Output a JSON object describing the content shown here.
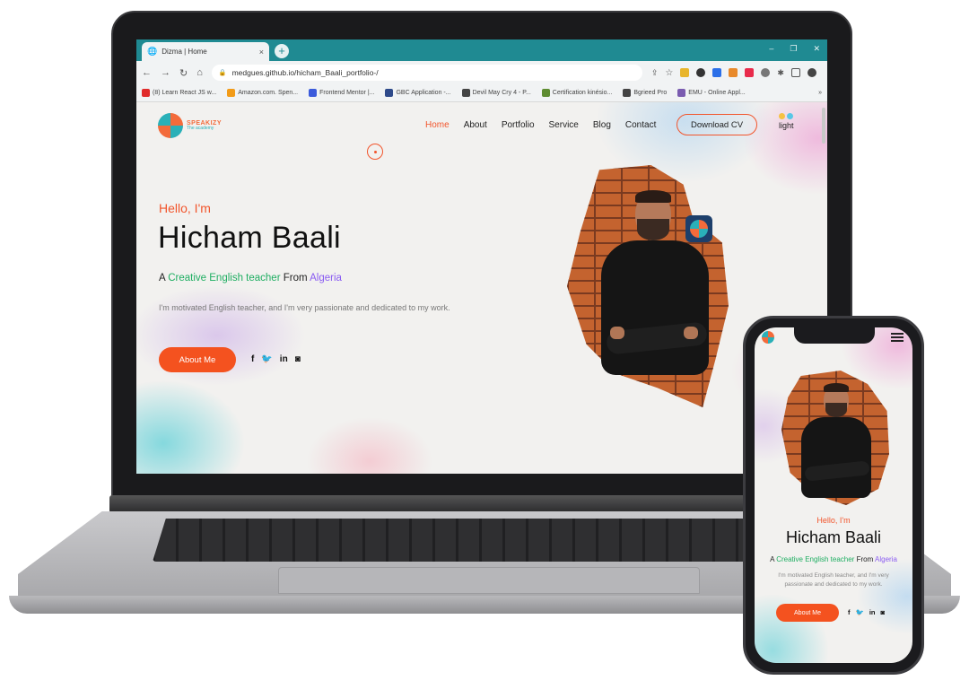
{
  "browser": {
    "tab_title": "Dizma | Home",
    "tab_close": "×",
    "new_tab": "+",
    "window_controls": [
      "‒",
      "❐",
      "✕"
    ],
    "url": "medgues.github.io/hicham_Baali_portfolio-/",
    "nav_glyphs": {
      "back": "←",
      "forward": "→",
      "reload": "↻",
      "home": "⌂",
      "menu": "⋮"
    },
    "bookmarks": [
      {
        "label": "(8) Learn React JS w...",
        "color": "#e02b2b"
      },
      {
        "label": "Amazon.com. Spen...",
        "color": "#f29b18"
      },
      {
        "label": "Frontend Mentor |...",
        "color": "#3b5bdb"
      },
      {
        "label": "GBC Application -...",
        "color": "#2e4a8a"
      },
      {
        "label": "Devil May Cry 4 - P...",
        "color": "#444444"
      },
      {
        "label": "Certification kinésio...",
        "color": "#5e8c31"
      },
      {
        "label": "Bgrieed Pro",
        "color": "#444444"
      },
      {
        "label": "EMU - Online Appl...",
        "color": "#7a5cb0"
      }
    ],
    "bookmarks_more": "»"
  },
  "site": {
    "logo": {
      "name": "SPEAKIZY",
      "sub": "The academy"
    },
    "nav": [
      {
        "label": "Home",
        "active": true
      },
      {
        "label": "About",
        "active": false
      },
      {
        "label": "Portfolio",
        "active": false
      },
      {
        "label": "Service",
        "active": false
      },
      {
        "label": "Blog",
        "active": false
      },
      {
        "label": "Contact",
        "active": false
      }
    ],
    "cv_button": "Download CV",
    "theme_label": "light",
    "hero": {
      "greeting": "Hello, I'm",
      "name": "Hicham Baali",
      "tagline_prefix": "A ",
      "tagline_highlight": "Creative English teacher",
      "tagline_mid": " From ",
      "tagline_country": "Algeria",
      "bio": "I'm motivated English teacher, and I'm very passionate and dedicated to my work.",
      "cta": "About Me",
      "socials": [
        "f",
        "🐦",
        "in",
        "◙"
      ]
    }
  },
  "colors": {
    "accent": "#f4521f",
    "highlight_green": "#1fae62",
    "highlight_purple": "#8a5cf2",
    "chrome_tab_bar": "#1f8a92"
  },
  "phone": {
    "greeting": "Hello, I'm",
    "name": "Hicham Baali",
    "tagline_prefix": "A ",
    "tagline_highlight": "Creative English teacher",
    "tagline_mid": " From ",
    "tagline_country": "Algeria",
    "bio": "I'm motivated English teacher, and I'm very passionate and dedicated to my work.",
    "cta": "About Me",
    "socials": [
      "f",
      "🐦",
      "in",
      "◙"
    ]
  }
}
